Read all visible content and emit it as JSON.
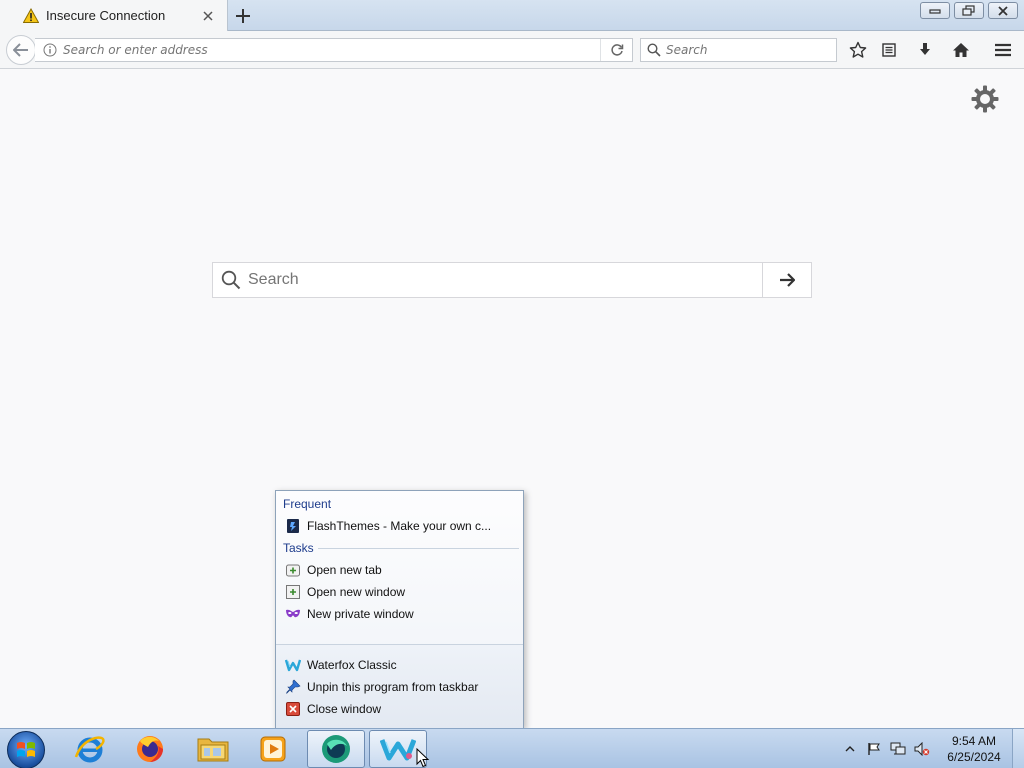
{
  "browser": {
    "tab": {
      "title": "Insecure Connection"
    },
    "urlbar": {
      "placeholder": "Search or enter address"
    },
    "searchbar": {
      "placeholder": "Search"
    }
  },
  "newtab_page": {
    "search": {
      "placeholder": "Search"
    }
  },
  "jumplist": {
    "frequent_header": "Frequent",
    "frequent_items": [
      {
        "label": "FlashThemes - Make your own c...",
        "icon": "flashthemes-icon"
      }
    ],
    "tasks_header": "Tasks",
    "tasks": [
      {
        "label": "Open new tab",
        "icon": "new-tab-icon"
      },
      {
        "label": "Open new window",
        "icon": "new-window-icon"
      },
      {
        "label": "New private window",
        "icon": "private-mask-icon"
      }
    ],
    "bottom": [
      {
        "label": "Waterfox Classic",
        "icon": "waterfox-icon"
      },
      {
        "label": "Unpin this program from taskbar",
        "icon": "unpin-icon"
      },
      {
        "label": "Close window",
        "icon": "close-window-icon"
      }
    ]
  },
  "taskbar": {
    "apps": [
      "internet-explorer-icon",
      "firefox-icon",
      "file-explorer-icon",
      "media-player-icon",
      "browser-app-icon",
      "waterfox-icon"
    ],
    "clock": {
      "time": "9:54 AM",
      "date": "6/25/2024"
    }
  },
  "colors": {
    "jumplist_header": "#1e3c8c",
    "taskbar": "#b6cde8",
    "page_background": "#f9f9fa"
  }
}
